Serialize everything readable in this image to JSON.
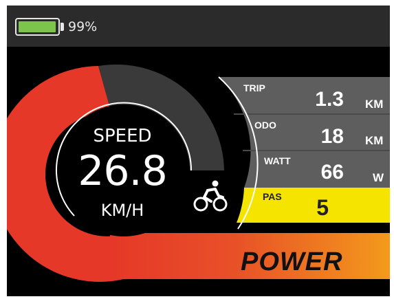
{
  "battery": {
    "level": 0.99,
    "text": "99%",
    "color": "#7cc44a"
  },
  "speed": {
    "title": "SPEED",
    "value": "26.8",
    "unit": "KM/H"
  },
  "trip": {
    "label": "TRIP",
    "value": "1.3",
    "unit": "KM"
  },
  "odo": {
    "label": "ODO",
    "value": "18",
    "unit": "KM"
  },
  "watt": {
    "label": "WATT",
    "value": "66",
    "unit": "W"
  },
  "pas": {
    "label": "PAS",
    "value": "5"
  },
  "power": {
    "label": "POWER"
  },
  "icons": {
    "bike": "bicycle-rider-icon",
    "battery": "battery-icon"
  },
  "colors": {
    "accent_red": "#e53828",
    "pas_yellow": "#f5e300",
    "panel_gray": "#5e5e5e",
    "power_orange": "#f39a1b"
  }
}
